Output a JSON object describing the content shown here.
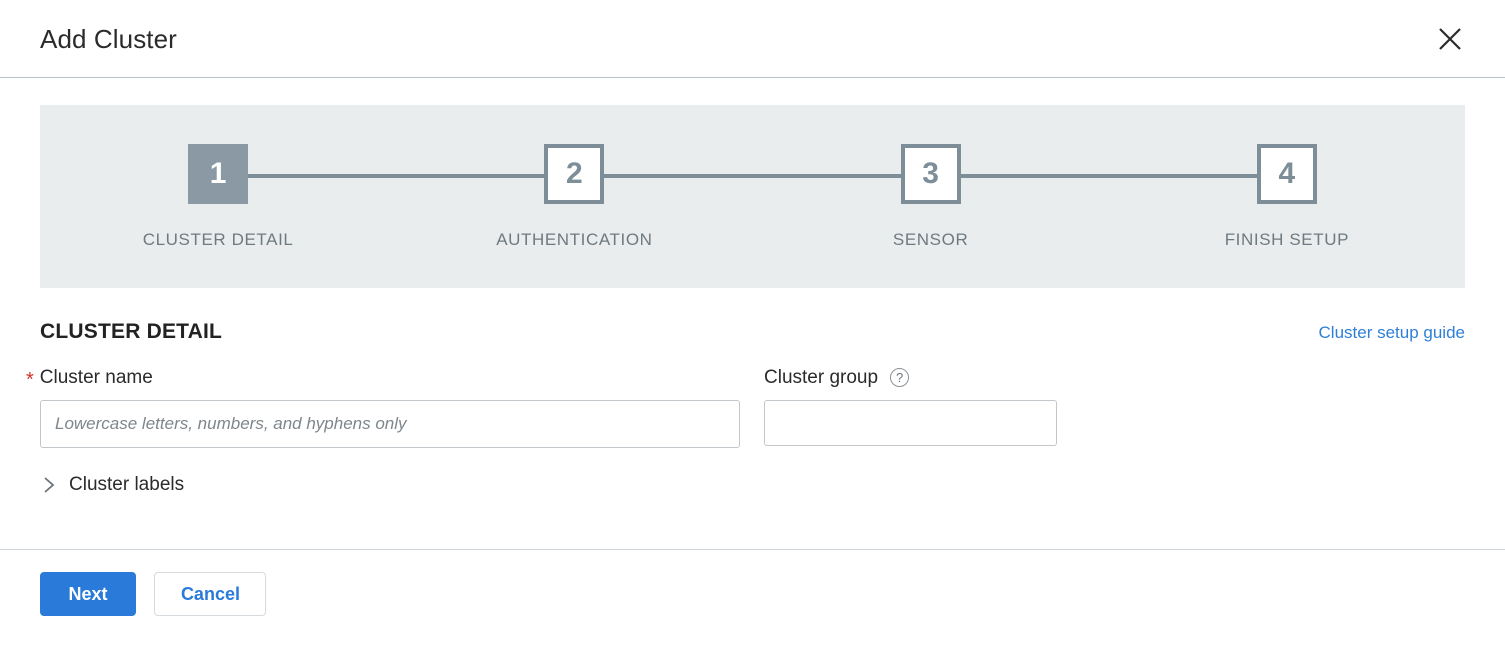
{
  "dialog": {
    "title": "Add Cluster",
    "close_icon": "close-icon"
  },
  "stepper": {
    "current_step": 1,
    "steps": [
      {
        "number": "1",
        "label": "CLUSTER DETAIL"
      },
      {
        "number": "2",
        "label": "AUTHENTICATION"
      },
      {
        "number": "3",
        "label": "SENSOR"
      },
      {
        "number": "4",
        "label": "FINISH SETUP"
      }
    ]
  },
  "section": {
    "title": "CLUSTER DETAIL",
    "link_label": "Cluster setup guide"
  },
  "form": {
    "cluster_name": {
      "label": "Cluster name",
      "required_marker": "*",
      "value": "",
      "placeholder": "Lowercase letters, numbers, and hyphens only"
    },
    "cluster_group": {
      "label": "Cluster group",
      "help_icon": "?",
      "value": "",
      "placeholder": ""
    },
    "cluster_labels": {
      "label": "Cluster labels",
      "expanded": false
    }
  },
  "footer": {
    "next_label": "Next",
    "cancel_label": "Cancel"
  },
  "colors": {
    "accent_blue": "#2a7ad9",
    "step_active": "#8a99a4",
    "step_inactive": "#7d8e99",
    "stepper_bg": "#e9edee",
    "required_red": "#d0342c"
  }
}
